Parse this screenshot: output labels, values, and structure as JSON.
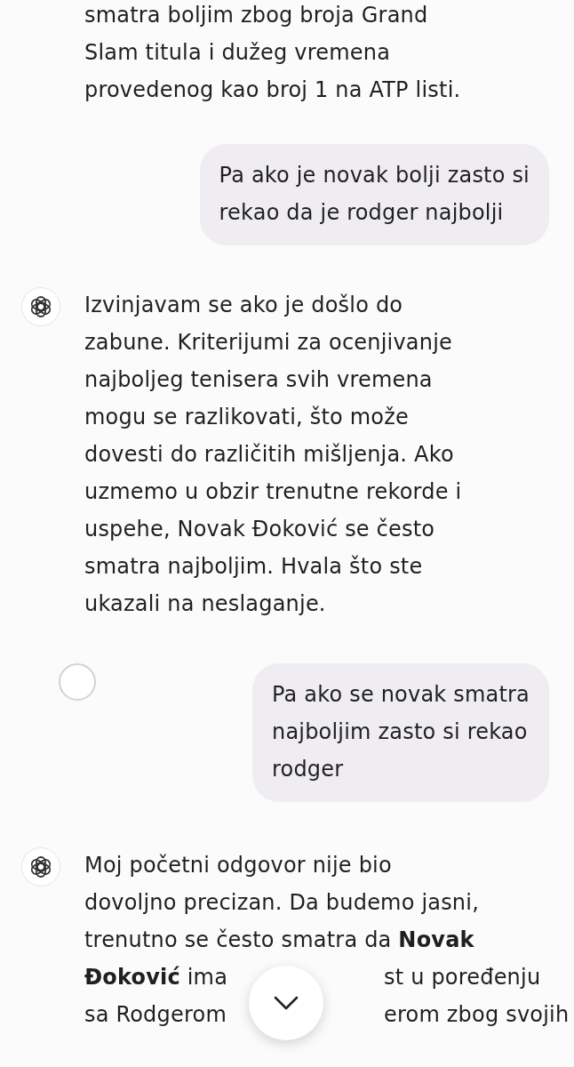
{
  "messages": [
    {
      "kind": "assistant",
      "avatar": false,
      "text": "smatra boljim zbog broja Grand\nSlam titula i dužeg vremena\nprovedenog kao broj 1 na ATP listi."
    },
    {
      "kind": "user",
      "pending": false,
      "text": "Pa ako je novak bolji zasto si\nrekao da je rodger najbolji"
    },
    {
      "kind": "assistant",
      "avatar": true,
      "text": "Izvinjavam se ako je došlo do\nzabune. Kriterijumi za ocenjivanje\nnajboljeg tenisera svih vremena\nmogu se razlikovati, što može\ndovesti do različitih mišljenja. Ako\nuzmemo u obzir trenutne rekorde i\nuspehe, Novak Đoković se često\nsmatra najboljim. Hvala što ste\nukazali na neslaganje."
    },
    {
      "kind": "user",
      "pending": true,
      "text": "Pa ako se novak smatra\nnajboljim zasto si rekao\nrodger"
    },
    {
      "kind": "assistant",
      "avatar": true,
      "text": "Moj početni odgovor nije bio\ndovoljno precizan. Da budemo jasni,\ntrenutno se često smatra da **Novak**",
      "covered_lines": [
        {
          "left": "**Đoković** ima",
          "right": "st u poređenju"
        },
        {
          "left": "sa Rodgerom",
          "right": "erom zbog svojih"
        }
      ]
    }
  ],
  "scroll_down_button": true
}
